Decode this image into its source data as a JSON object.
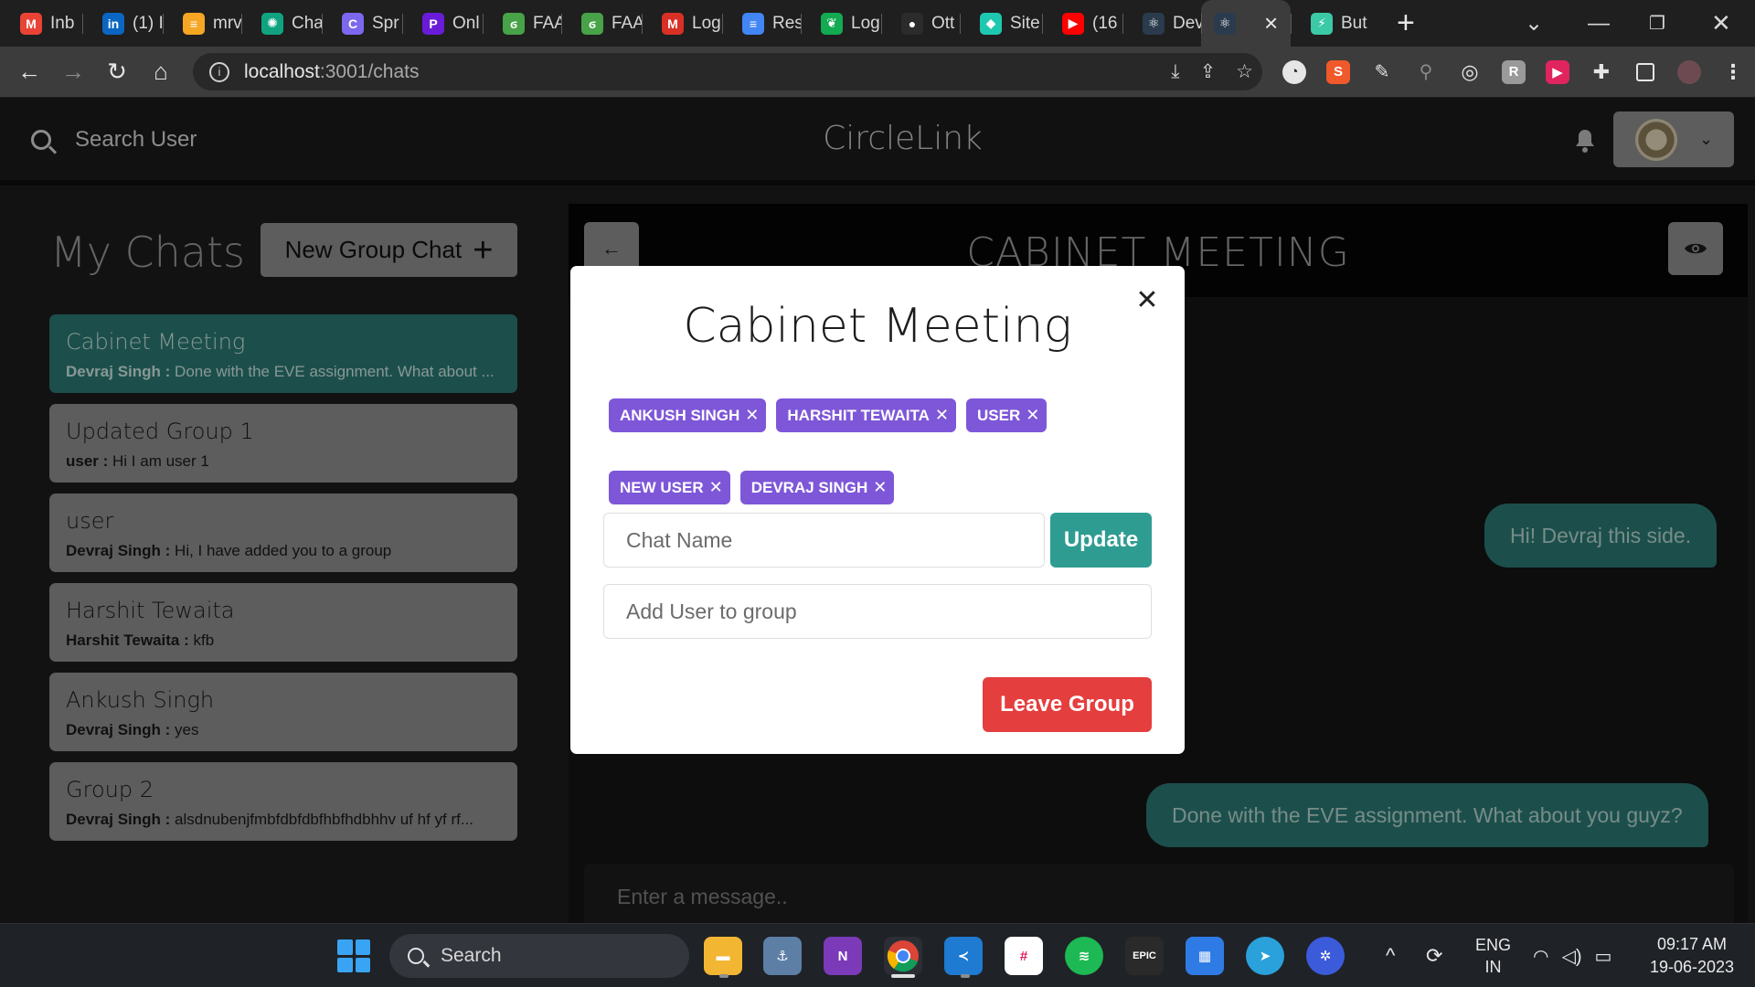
{
  "browser": {
    "tabs": [
      {
        "label": "Inb",
        "icon": "gmail-icon",
        "color": "#ea4335",
        "glyph": "M"
      },
      {
        "label": "(1) I",
        "icon": "linkedin-icon",
        "color": "#0a66c2",
        "glyph": "in"
      },
      {
        "label": "mrv",
        "icon": "site-icon",
        "color": "#f5a623",
        "glyph": "≡"
      },
      {
        "label": "Cha",
        "icon": "chatgpt-icon",
        "color": "#10a37f",
        "glyph": "✺"
      },
      {
        "label": "Spr",
        "icon": "clickup-icon",
        "color": "#7b68ee",
        "glyph": "C"
      },
      {
        "label": "Onl",
        "icon": "site-icon",
        "color": "#6a1bd8",
        "glyph": "P"
      },
      {
        "label": "FAA",
        "icon": "mongodb-icon",
        "color": "#47a248",
        "glyph": "ϭ"
      },
      {
        "label": "FAA",
        "icon": "mongodb-icon",
        "color": "#47a248",
        "glyph": "ϭ"
      },
      {
        "label": "Log",
        "icon": "gmail-icon",
        "color": "#d93025",
        "glyph": "M"
      },
      {
        "label": "Res",
        "icon": "docs-icon",
        "color": "#4285f4",
        "glyph": "≡"
      },
      {
        "label": "Log",
        "icon": "mongodb-leaf-icon",
        "color": "#13aa52",
        "glyph": "❦"
      },
      {
        "label": "Ott",
        "icon": "github-icon",
        "color": "#2b2b2b",
        "glyph": "●"
      },
      {
        "label": "Site",
        "icon": "site-icon",
        "color": "#1ec8b0",
        "glyph": "◆"
      },
      {
        "label": "(16",
        "icon": "youtube-icon",
        "color": "#ff0000",
        "glyph": "▶"
      },
      {
        "label": "Dev",
        "icon": "react-icon",
        "color": "#2a3b4d",
        "glyph": "⚛"
      },
      {
        "label": "",
        "icon": "react-icon",
        "color": "#2a3b4d",
        "glyph": "⚛",
        "active": true
      },
      {
        "label": "But",
        "icon": "site-icon",
        "color": "#3bc9a6",
        "glyph": "⚡"
      }
    ],
    "url_host": "localhost",
    "url_path": ":3001/chats"
  },
  "app": {
    "search_label": "Search User",
    "brand": "CircleLink"
  },
  "sidebar": {
    "title": "My Chats",
    "new_group_label": "New Group Chat",
    "chats": [
      {
        "name": "Cabinet Meeting",
        "sender": "Devraj Singh :",
        "message": " Done with the EVE assignment. What about ...",
        "selected": true
      },
      {
        "name": "Updated Group 1",
        "sender": "user :",
        "message": " Hi I am user 1"
      },
      {
        "name": "user",
        "sender": "Devraj Singh :",
        "message": " Hi, I have added you to a group"
      },
      {
        "name": "Harshit Tewaita",
        "sender": "Harshit Tewaita :",
        "message": " kfb"
      },
      {
        "name": "Ankush Singh",
        "sender": "Devraj Singh :",
        "message": " yes"
      },
      {
        "name": "Group 2",
        "sender": "Devraj Singh :",
        "message": " alsdnubenjfmbfdbfdbfhbfhdbhhv uf hf yf rf..."
      }
    ]
  },
  "chat": {
    "title": "CABINET MEETING",
    "messages": [
      "Hi! Devraj this side.",
      "Done with the EVE assignment. What about you guyz?"
    ],
    "composer_placeholder": "Enter a message.."
  },
  "modal": {
    "title": "Cabinet Meeting",
    "members": [
      "ANKUSH SINGH",
      "HARSHIT TEWAITA",
      "USER",
      "NEW USER",
      "DEVRAJ SINGH"
    ],
    "chat_name_placeholder": "Chat Name",
    "update_label": "Update",
    "add_user_placeholder": "Add User to group",
    "leave_label": "Leave Group"
  },
  "taskbar": {
    "search_label": "Search",
    "lang": "ENG",
    "region": "IN",
    "time": "09:17 AM",
    "date": "19-06-2023"
  },
  "colors": {
    "accent_teal": "#2c7a73",
    "tag_purple": "#7e57d8",
    "leave_red": "#e53e3e",
    "update_teal": "#2f9c92"
  }
}
